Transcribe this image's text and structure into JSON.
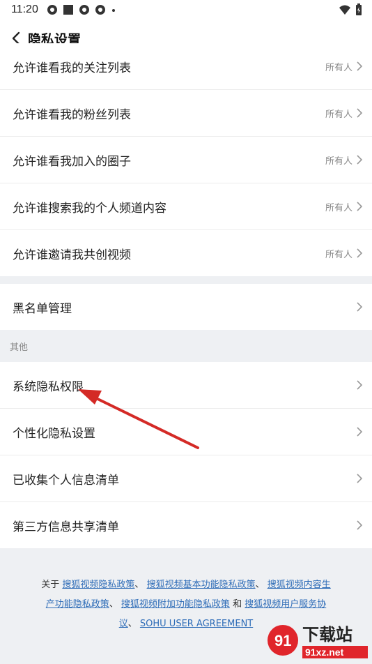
{
  "status": {
    "time": "11:20"
  },
  "header": {
    "title": "隐私设置"
  },
  "privacy_rows": [
    {
      "label": "允许谁看我的关注列表",
      "value": "所有人"
    },
    {
      "label": "允许谁看我的粉丝列表",
      "value": "所有人"
    },
    {
      "label": "允许谁看我加入的圈子",
      "value": "所有人"
    },
    {
      "label": "允许谁搜索我的个人频道内容",
      "value": "所有人"
    },
    {
      "label": "允许谁邀请我共创视频",
      "value": "所有人"
    }
  ],
  "blacklist": {
    "label": "黑名单管理"
  },
  "other_section": {
    "header": "其他",
    "rows": [
      {
        "label": "系统隐私权限"
      },
      {
        "label": "个性化隐私设置"
      },
      {
        "label": "已收集个人信息清单"
      },
      {
        "label": "第三方信息共享清单"
      }
    ]
  },
  "footer": {
    "prefix": "关于 ",
    "sep1": "、 ",
    "sep2": "、 ",
    "and": " 和 ",
    "sep3": "、 ",
    "links": [
      "搜狐视频隐私政策",
      "搜狐视频基本功能隐私政策",
      "搜狐视频内容生",
      "产功能隐私政策",
      "搜狐视频附加功能隐私政策",
      "搜狐视频用户服务协",
      "议",
      "SOHU USER AGREEMENT"
    ]
  },
  "watermark": {
    "text": "下载站",
    "domain": "91xz.net"
  },
  "colors": {
    "link": "#2f6db8",
    "arrow": "#d42a26",
    "background": "#eef0f3"
  }
}
